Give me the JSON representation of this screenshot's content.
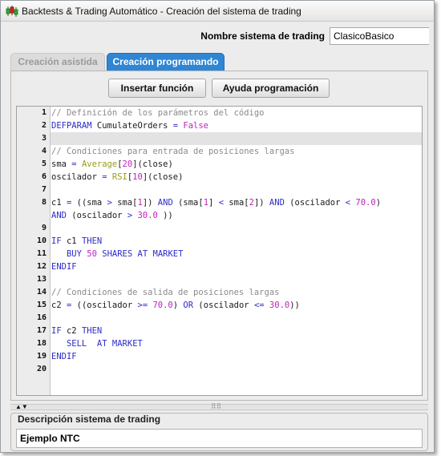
{
  "window": {
    "title": "Backtests & Trading Automático - Creación del sistema de trading",
    "icon": "candlestick-chart-icon"
  },
  "system_name": {
    "label": "Nombre sistema de trading",
    "value": "ClasicoBasico"
  },
  "tabs": [
    {
      "label": "Creación asistida",
      "active": false
    },
    {
      "label": "Creación programando",
      "active": true
    }
  ],
  "buttons": {
    "insert_function": "Insertar función",
    "programming_help": "Ayuda programación"
  },
  "editor": {
    "line_numbers": [
      "1",
      "2",
      "3",
      "4",
      "5",
      "6",
      "7",
      "8",
      "",
      "9",
      "10",
      "11",
      "12",
      "13",
      "14",
      "15",
      "16",
      "17",
      "18",
      "19",
      "20"
    ],
    "highlighted_line": "3",
    "code_lines": [
      "// Definición de los parámetros del código",
      "DEFPARAM CumulateOrders = False",
      "",
      "// Condiciones para entrada de posiciones largas",
      "sma = Average[20](close)",
      "oscilador = RSI[10](close)",
      "",
      "c1 = ((sma > sma[1]) AND (sma[1] < sma[2]) AND (oscilador < 70.0)",
      "AND (oscilador > 30.0 ))",
      "",
      "IF c1 THEN",
      "   BUY 50 SHARES AT MARKET",
      "ENDIF",
      "",
      "// Condiciones de salida de posiciones largas",
      "c2 = ((oscilador >= 70.0) OR (oscilador <= 30.0))",
      "",
      "IF c2 THEN",
      "   SELL  AT MARKET",
      "ENDIF",
      ""
    ]
  },
  "splitter": {
    "arrows": "▲▼",
    "grip": "⠿⠿"
  },
  "description": {
    "title": "Descripción sistema de trading",
    "value": "Ejemplo NTC"
  },
  "colors": {
    "active_tab": "#2f86d4",
    "keyword": "#2c2cc8",
    "comment": "#8a8a8a",
    "number": "#c020c0",
    "function": "#9a9a1a"
  }
}
